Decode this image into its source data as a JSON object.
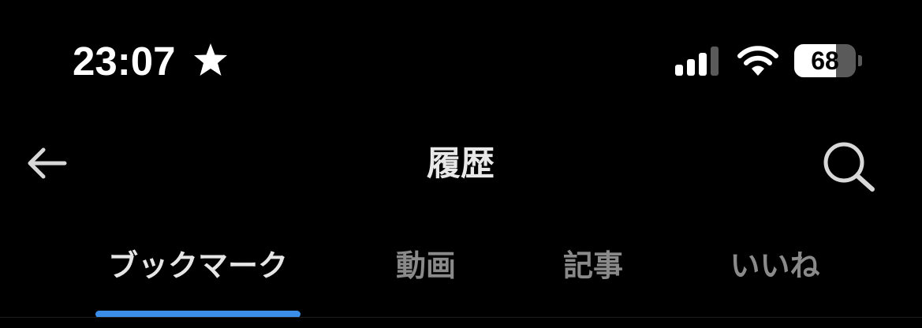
{
  "status_bar": {
    "time": "23:07",
    "battery_level": "68",
    "battery_fraction": 0.68,
    "signal_bars_active": 3,
    "signal_bars_total": 4,
    "icons": [
      "star-icon",
      "cellular-signal-icon",
      "wifi-icon",
      "battery-icon"
    ]
  },
  "header": {
    "title": "履歴",
    "back_icon": "arrow-left-icon",
    "search_icon": "search-icon"
  },
  "tabs": [
    {
      "label": "ブックマーク",
      "active": true
    },
    {
      "label": "動画",
      "active": false
    },
    {
      "label": "記事",
      "active": false
    },
    {
      "label": "いいね",
      "active": false
    }
  ],
  "colors": {
    "background": "#000000",
    "active_tab_text": "#e6e6e6",
    "inactive_tab_text": "#8a8a8a",
    "tab_indicator": "#3b8ee8"
  }
}
